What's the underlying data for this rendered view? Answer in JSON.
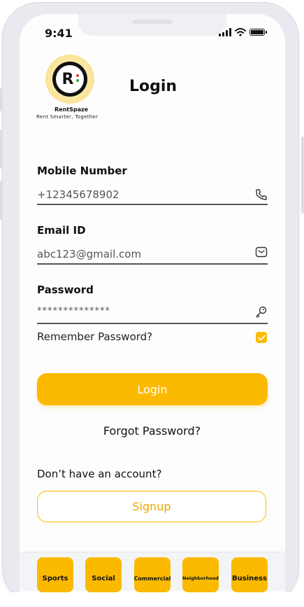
{
  "status": {
    "time": "9:41"
  },
  "brand": {
    "name": "RentSpaze",
    "tagline": "Rent Smarter, Together"
  },
  "page": {
    "title": "Login"
  },
  "form": {
    "mobile": {
      "label": "Mobile Number",
      "value": "+12345678902",
      "icon": "phone-icon"
    },
    "email": {
      "label": "Email ID",
      "value": "abc123@gmail.com",
      "icon": "mail-icon"
    },
    "password": {
      "label": "Password",
      "value": "**************",
      "icon": "key-icon"
    },
    "remember": {
      "label": "Remember Password?",
      "checked": true
    }
  },
  "actions": {
    "login_label": "Login",
    "forgot_label": "Forgot Password?",
    "no_account_text": "Don’t have an account?",
    "signup_label": "Signup"
  },
  "tabs": [
    {
      "label": "Sports"
    },
    {
      "label": "Social"
    },
    {
      "label": "Commercial"
    },
    {
      "label": "Neighborhood"
    },
    {
      "label": "Business"
    }
  ],
  "colors": {
    "accent": "#fbba00",
    "text": "#111111",
    "muted": "#555555"
  }
}
